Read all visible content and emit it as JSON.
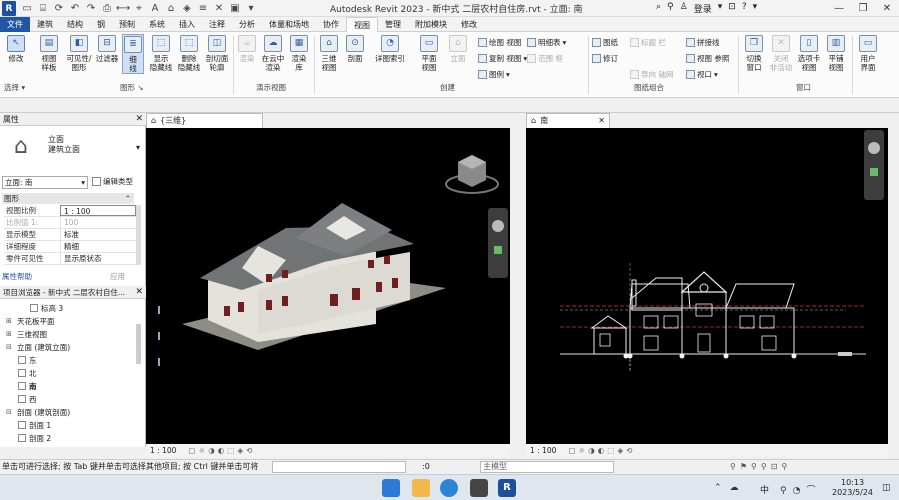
{
  "app": {
    "title": "Autodesk Revit 2023 - 新中式 二层农村自住房.rvt - 立面: 南",
    "logo": "R",
    "user": "登录"
  },
  "tabs": [
    "文件",
    "建筑",
    "结构",
    "钢",
    "预制",
    "系统",
    "插入",
    "注释",
    "分析",
    "体量和场地",
    "协作",
    "视图",
    "管理",
    "附加模块",
    "修改"
  ],
  "active_tab": "视图",
  "ribbon": {
    "modify": "修改",
    "select_panel": "选择",
    "graphics": {
      "label": "图形",
      "items": [
        "视图\n样板",
        "可见性/\n图形",
        "过滤器",
        "细\n线",
        "显示\n隐藏线",
        "删除\n隐藏线",
        "剖切面\n轮廓"
      ]
    },
    "presentation": {
      "label": "演示视图",
      "items": [
        "渲染",
        "在云中\n渲染",
        "渲染\n库"
      ]
    },
    "create": {
      "label": "创建",
      "items": [
        "三维\n视图",
        "剖面",
        "详图索引",
        "平面\n视图",
        "立面"
      ],
      "small": [
        "绘图 视图",
        "复制 视图",
        "图例"
      ],
      "small2": [
        "明细表",
        "范围 框"
      ]
    },
    "sheet": {
      "label": "图纸组合",
      "items": [
        "图纸",
        "修订",
        "导向 轴网",
        "标题 栏",
        "拼接线",
        "视图 参照",
        "视口"
      ]
    },
    "windows": {
      "label": "窗口",
      "items": [
        "切换\n窗口",
        "关闭\n非活动",
        "选项卡\n视图",
        "平铺\n视图",
        "用户\n界面"
      ]
    }
  },
  "properties": {
    "title": "属性",
    "type_name": "立面",
    "type_sub": "建筑立面",
    "selector": "立面: 南",
    "edit_type": "编辑类型",
    "section": "图形",
    "rows": [
      {
        "k": "视图比例",
        "v": "1 : 100"
      },
      {
        "k": "比例值 1:",
        "v": "100"
      },
      {
        "k": "显示模型",
        "v": "标准"
      },
      {
        "k": "详细程度",
        "v": "精细"
      },
      {
        "k": "零件可见性",
        "v": "显示原状态"
      }
    ],
    "help": "属性帮助",
    "apply": "应用"
  },
  "browser": {
    "title": "项目浏览器 - 新中式 二层农村自住...",
    "items": [
      {
        "label": "标高 3",
        "level": 3,
        "icon": true
      },
      {
        "label": "天花板平面",
        "level": 1,
        "exp": "+"
      },
      {
        "label": "三维视图",
        "level": 1,
        "exp": "+"
      },
      {
        "label": "立面 (建筑立面)",
        "level": 1,
        "exp": "−"
      },
      {
        "label": "东",
        "level": 2,
        "icon": true
      },
      {
        "label": "北",
        "level": 2,
        "icon": true
      },
      {
        "label": "南",
        "level": 2,
        "icon": true,
        "selected": true
      },
      {
        "label": "西",
        "level": 2,
        "icon": true
      },
      {
        "label": "剖面 (建筑剖面)",
        "level": 1,
        "exp": "−"
      },
      {
        "label": "剖面 1",
        "level": 2,
        "icon": true
      },
      {
        "label": "剖面 2",
        "level": 2,
        "icon": true
      }
    ]
  },
  "views": {
    "left_tab": "{三维}",
    "right_tab": "南",
    "left_scale": "1 : 100",
    "right_scale": "1 : 100"
  },
  "status": {
    "text": "单击可进行选择; 按 Tab 键并单击可选择其他项目; 按 Ctrl 键并单击可将",
    "count": ":0",
    "model": "主模型"
  },
  "taskbar": {
    "lang": "中",
    "time": "10:13",
    "date": "2023/5/24"
  }
}
